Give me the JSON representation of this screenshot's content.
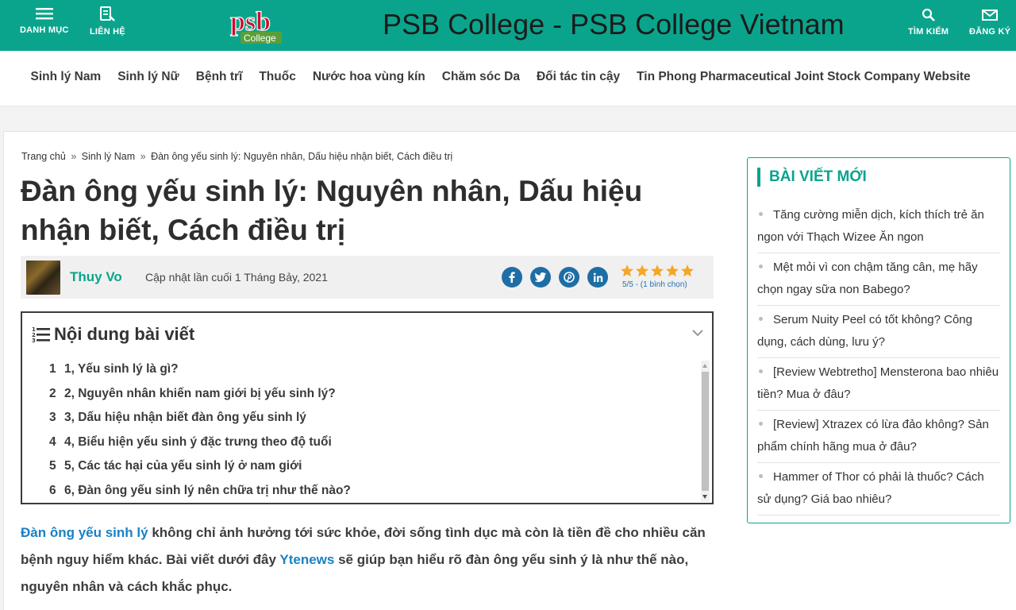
{
  "header": {
    "menu_label": "DANH MỤC",
    "contact_label": "LIÊN HỆ",
    "logo_text_top": "psb",
    "logo_text_bottom": "College",
    "site_title": "PSB College - PSB College Vietnam",
    "search_label": "TÌM KIẾM",
    "register_label": "ĐĂNG KÝ",
    "brand_color": "#0aa48c"
  },
  "nav": {
    "items": [
      {
        "label": "Sinh lý Nam"
      },
      {
        "label": "Sinh lý Nữ"
      },
      {
        "label": "Bệnh trĩ"
      },
      {
        "label": "Thuốc"
      },
      {
        "label": "Nước hoa vùng kín"
      },
      {
        "label": "Chăm sóc Da"
      },
      {
        "label": "Đối tác tin cậy"
      },
      {
        "label": "Tin Phong Pharmaceutical Joint Stock Company Website"
      }
    ]
  },
  "breadcrumb": {
    "home": "Trang chủ",
    "separator": "»",
    "category": "Sinh lý Nam",
    "current": "Đàn ông yếu sinh lý: Nguyên nhân, Dấu hiệu nhận biết, Cách điều trị"
  },
  "article": {
    "title": "Đàn ông yếu sinh lý: Nguyên nhân, Dấu hiệu nhận biết, Cách điều trị",
    "author": "Thuy Vo",
    "updated": "Cập nhật lần cuối 1 Tháng Bảy, 2021",
    "share_icons": [
      "facebook-icon",
      "twitter-icon",
      "pinterest-icon",
      "linkedin-icon"
    ],
    "rating": {
      "stars": 5,
      "max": 5,
      "text": "5/5 - (1 bình chọn)"
    },
    "intro": {
      "link1": "Đàn ông yếu sinh lý",
      "text1": " không chỉ ảnh hưởng tới sức khỏe, đời sống tình dục mà còn là tiền đề cho nhiều căn bệnh nguy hiểm khác. Bài viết dưới đây ",
      "link2": "Ytenews",
      "text2": " sẽ giúp bạn hiểu rõ đàn ông yếu sinh ý là như thế nào, nguyên nhân và cách khắc phục."
    }
  },
  "toc": {
    "title": "Nội dung bài viết",
    "items": [
      {
        "num": "1",
        "label": "1, Yếu sinh lý là gì?"
      },
      {
        "num": "2",
        "label": "2, Nguyên nhân khiến nam giới bị yếu sinh lý?"
      },
      {
        "num": "3",
        "label": "3, Dấu hiệu nhận biết đàn ông yếu sinh lý"
      },
      {
        "num": "4",
        "label": "4, Biểu hiện yếu sinh ý đặc trưng theo độ tuổi"
      },
      {
        "num": "5",
        "label": "5, Các tác hại của yếu sinh lý ở nam giới"
      },
      {
        "num": "6",
        "label": "6, Đàn ông yếu sinh lý nên chữa trị như thế nào?"
      }
    ]
  },
  "sidebar": {
    "title": "BÀI VIẾT MỚI",
    "items": [
      {
        "label": "Tăng cường miễn dịch, kích thích trẻ ăn ngon với Thạch Wizee Ăn ngon"
      },
      {
        "label": "Mệt mỏi vì con chậm tăng cân, mẹ hãy chọn ngay sữa non Babego?"
      },
      {
        "label": "Serum Nuity Peel có tốt không? Công dụng, cách dùng, lưu ý?"
      },
      {
        "label": "[Review Webtretho] Mensterona bao nhiêu tiền? Mua ở đâu?"
      },
      {
        "label": "[Review] Xtrazex có lừa đảo không? Sản phẩm chính hãng mua ở đâu?"
      },
      {
        "label": "Hammer of Thor có phải là thuốc? Cách sử dụng? Giá bao nhiêu?"
      }
    ]
  }
}
